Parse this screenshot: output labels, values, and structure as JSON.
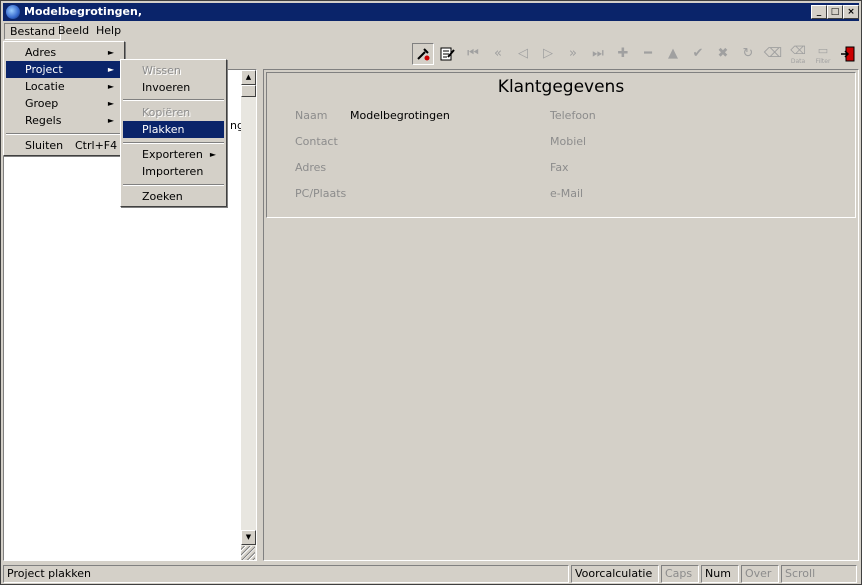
{
  "window": {
    "title": "Modelbegrotingen,",
    "minimize": "_",
    "maximize": "□",
    "close": "×"
  },
  "menubar": {
    "items": [
      "Bestand",
      "Beeld",
      "Help"
    ]
  },
  "bestand_menu": {
    "items": [
      {
        "label": "Adres",
        "arrow": "►"
      },
      {
        "label": "Project",
        "arrow": "►"
      },
      {
        "label": "Locatie",
        "arrow": "►"
      },
      {
        "label": "Groep",
        "arrow": "►"
      },
      {
        "label": "Regels",
        "arrow": "►"
      },
      {
        "label": "Sluiten",
        "shortcut": "Ctrl+F4"
      }
    ]
  },
  "project_menu": {
    "items": [
      {
        "label": "Wissen"
      },
      {
        "label": "Invoeren"
      },
      {
        "label": "Kopiëren"
      },
      {
        "label": "Plakken"
      },
      {
        "label": "Exporteren",
        "arrow": "►"
      },
      {
        "label": "Importeren"
      },
      {
        "label": "Zoeken"
      }
    ]
  },
  "tree": {
    "fragment": "ng"
  },
  "toolbar": {
    "data_label": "Data",
    "filter_label": "Filter"
  },
  "klant": {
    "title": "Klantgegevens",
    "labels": {
      "naam": "Naam",
      "contact": "Contact",
      "adres": "Adres",
      "pcplaats": "PC/Plaats",
      "telefoon": "Telefoon",
      "mobiel": "Mobiel",
      "fax": "Fax",
      "email": "e-Mail"
    },
    "values": {
      "naam": "Modelbegrotingen"
    }
  },
  "status": {
    "message": "Project plakken",
    "mode": "Voorcalculatie",
    "caps": "Caps",
    "num": "Num",
    "over": "Over",
    "scroll": "Scroll"
  }
}
